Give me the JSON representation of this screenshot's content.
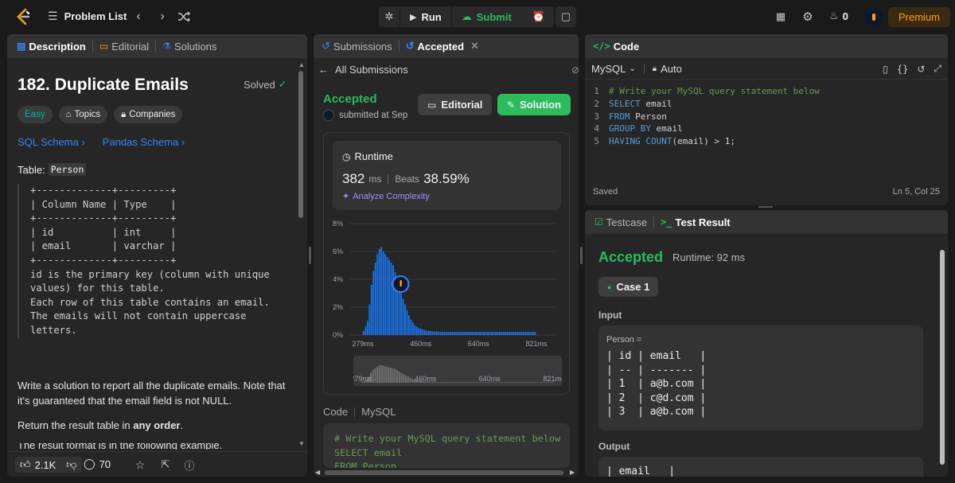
{
  "topbar": {
    "problem_list": "Problem List",
    "run": "Run",
    "submit": "Submit",
    "streak": "0",
    "premium": "Premium"
  },
  "left": {
    "tabs": [
      "Description",
      "Editorial",
      "Solutions"
    ],
    "title": "182. Duplicate Emails",
    "solved": "Solved",
    "difficulty": "Easy",
    "topics": "Topics",
    "companies": "Companies",
    "sql_schema": "SQL Schema",
    "pandas_schema": "Pandas Schema",
    "table_label": "Table:",
    "table_name": "Person",
    "schema_text": "+-------------+---------+\n| Column Name | Type    |\n+-------------+---------+\n| id          | int     |\n| email       | varchar |\n+-------------+---------+\nid is the primary key (column with unique\nvalues) for this table.\nEach row of this table contains an email.\nThe emails will not contain uppercase\nletters.",
    "para1": "Write a solution to report all the duplicate emails. Note that it's guaranteed that the email field is not NULL.",
    "para2_prefix": "Return the result table in ",
    "para2_bold": "any order",
    "para2_suffix": ".",
    "para3": "The result format is in the following example.",
    "likes": "2.1K",
    "comments": "70"
  },
  "middle": {
    "tabs": [
      "Submissions",
      "Accepted"
    ],
    "all_submissions": "All Submissions",
    "status": "Accepted",
    "submitted": "submitted at Sep",
    "editorial_btn": "Editorial",
    "solution_btn": "Solution",
    "runtime_label": "Runtime",
    "runtime_value": "382",
    "runtime_unit": "ms",
    "beats_label": "Beats",
    "beats_value": "38.59%",
    "analyze": "Analyze Complexity",
    "code_label": "Code",
    "code_lang": "MySQL",
    "code_preview": "# Write your MySQL query statement below\nSELECT email\nFROM Person"
  },
  "chart_data": {
    "type": "bar",
    "title": "",
    "xlabel": "",
    "ylabel": "",
    "ylim": [
      0,
      8
    ],
    "yticks": [
      "8%",
      "6%",
      "4%",
      "2%",
      "0%"
    ],
    "xticks": [
      "279ms",
      "460ms",
      "640ms",
      "821ms"
    ],
    "xrange_ms": [
      279,
      821
    ],
    "highlight_ms": 382,
    "values": [
      0.3,
      0.6,
      1.0,
      2.2,
      3.6,
      4.6,
      5.2,
      5.8,
      6.2,
      6.3,
      6.0,
      5.8,
      5.6,
      5.4,
      5.2,
      5.0,
      4.5,
      4.0,
      3.5,
      3.0,
      2.6,
      2.2,
      1.8,
      1.4,
      1.1,
      0.9,
      0.7,
      0.6,
      0.5,
      0.45,
      0.4,
      0.35,
      0.3,
      0.3,
      0.28,
      0.25,
      0.25,
      0.25,
      0.22,
      0.22,
      0.22,
      0.22,
      0.22,
      0.22,
      0.22,
      0.22,
      0.22,
      0.22,
      0.22,
      0.22,
      0.22,
      0.22,
      0.22,
      0.22,
      0.22,
      0.22,
      0.22,
      0.22,
      0.22,
      0.22,
      0.22,
      0.22,
      0.22,
      0.22,
      0.22,
      0.22,
      0.22,
      0.22,
      0.22,
      0.22,
      0.22,
      0.22,
      0.22,
      0.22,
      0.22,
      0.22,
      0.22,
      0.22,
      0.22,
      0.22,
      0.22,
      0.22,
      0.22,
      0.22,
      0.22,
      0.22,
      0.22,
      0.22
    ]
  },
  "editor": {
    "tab": "Code",
    "lang": "MySQL",
    "auto": "Auto",
    "lines": [
      {
        "n": "1",
        "t": "# Write your MySQL query statement below"
      },
      {
        "n": "2",
        "t": "SELECT email"
      },
      {
        "n": "3",
        "t": "FROM Person"
      },
      {
        "n": "4",
        "t": "GROUP BY email"
      },
      {
        "n": "5",
        "t": "HAVING COUNT(email) > 1;"
      }
    ],
    "saved": "Saved",
    "cursor": "Ln 5, Col 25"
  },
  "result": {
    "tabs": [
      "Testcase",
      "Test Result"
    ],
    "status": "Accepted",
    "runtime": "Runtime: 92 ms",
    "case": "Case 1",
    "input_label": "Input",
    "person_label": "Person =",
    "input_table": "| id | email   |\n| -- | ------- |\n| 1  | a@b.com |\n| 2  | c@d.com |\n| 3  | a@b.com |",
    "output_label": "Output",
    "output_table": "| email   |"
  },
  "colors": {
    "accent_green": "#2cbb5d",
    "accent_blue": "#3b82f6",
    "accent_orange": "#ffa116",
    "bar_blue": "#1a73e8"
  }
}
